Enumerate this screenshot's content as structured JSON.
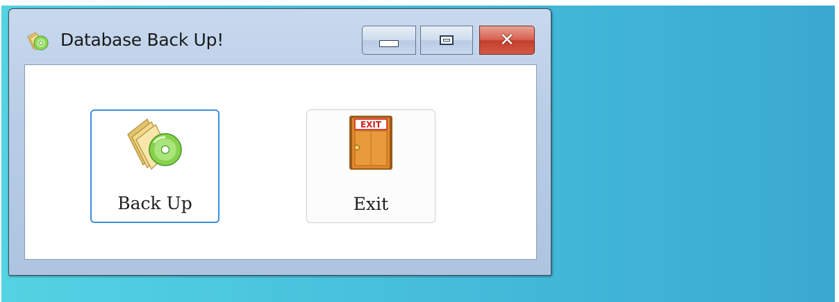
{
  "window": {
    "title": "Database Back Up!",
    "icon": "disc-with-folders-icon"
  },
  "title_buttons": {
    "minimize": "minimize-icon",
    "maximize": "maximize-icon",
    "close": "close-icon"
  },
  "actions": [
    {
      "label": "Back Up",
      "icon": "backup-disc-icon",
      "focused": true
    },
    {
      "label": "Exit",
      "icon": "exit-door-icon",
      "focused": false
    }
  ],
  "exit_sign_text": "EXIT",
  "colors": {
    "desktop_start": "#54d3e3",
    "desktop_end": "#3aa9d1",
    "focus_border": "#3b8fdc",
    "close_button": "#c33e2c"
  }
}
